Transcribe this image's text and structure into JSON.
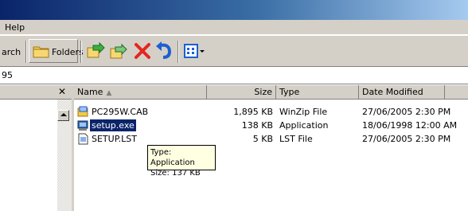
{
  "window": {
    "title": ""
  },
  "menu": {
    "help": "Help"
  },
  "toolbar": {
    "search_label": "arch",
    "folders_label": "Folders"
  },
  "address": {
    "value": "95"
  },
  "left_pane": {
    "close": "✕"
  },
  "list": {
    "columns": [
      {
        "label": "Name"
      },
      {
        "label": "Size"
      },
      {
        "label": "Type"
      },
      {
        "label": "Date Modified"
      }
    ],
    "rows": [
      {
        "name": "PC295W.CAB",
        "size": "1,895 KB",
        "type": "WinZip File",
        "date": "27/06/2005 2:30 PM",
        "icon": "cab-file-icon"
      },
      {
        "name": "setup.exe",
        "size": "138 KB",
        "type": "Application",
        "date": "18/06/1998 12:00 AM",
        "icon": "setup-exe-icon",
        "selected": true
      },
      {
        "name": "SETUP.LST",
        "size": "5 KB",
        "type": "LST File",
        "date": "27/06/2005 2:30 PM",
        "icon": "text-file-icon"
      }
    ]
  },
  "tooltip": {
    "line1": "Type: Application",
    "line2": "Size: 137 KB"
  },
  "colors": {
    "selection": "#0a246a",
    "chrome": "#d4d0c8",
    "tooltip_bg": "#ffffe1"
  }
}
